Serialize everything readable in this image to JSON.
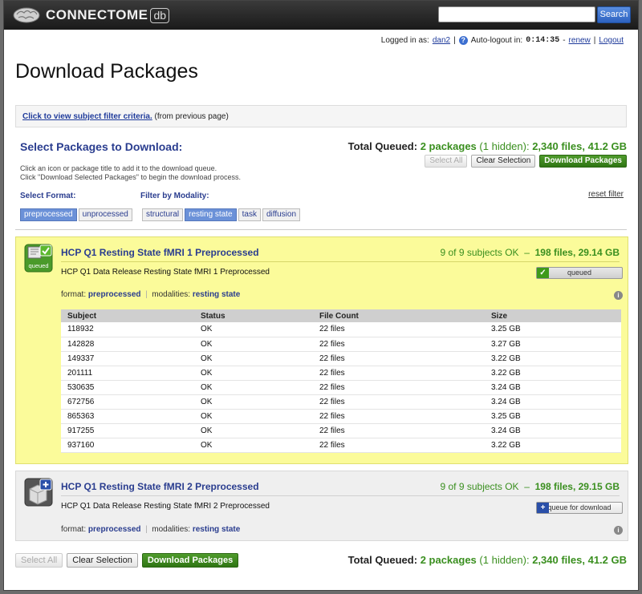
{
  "header": {
    "logo_text": "CONNECTOME",
    "logo_badge": "db",
    "search_placeholder": "",
    "search_button": "Search"
  },
  "userbar": {
    "logged_in_label": "Logged in as:",
    "username": "dan2",
    "sep1": "|",
    "auto_logout_label": "Auto-logout in:",
    "timer": "0:14:35",
    "dash": "-",
    "renew": "renew",
    "sep2": "|",
    "logout": "Logout"
  },
  "page_title": "Download Packages",
  "filter_bar": {
    "link": "Click to view subject filter criteria.",
    "note": "(from previous page)"
  },
  "select": {
    "heading": "Select Packages to Download:",
    "instruction_1": "Click an icon or package title to add it to the download queue.",
    "instruction_2": "Click \"Download Selected Packages\" to begin the download process."
  },
  "totals": {
    "label": "Total Queued:",
    "packages": "2 packages",
    "hidden": "(1 hidden):",
    "summary": "2,340 files, 41.2 GB"
  },
  "buttons": {
    "select_all": "Select All",
    "clear_selection": "Clear Selection",
    "download": "Download Packages"
  },
  "filters": {
    "format_label": "Select Format:",
    "modality_label": "Filter by Modality:",
    "reset": "reset filter",
    "formats": [
      {
        "label": "preprocessed",
        "active": true
      },
      {
        "label": "unprocessed",
        "active": false
      }
    ],
    "modalities": [
      {
        "label": "structural",
        "active": false
      },
      {
        "label": "resting state",
        "active": true
      },
      {
        "label": "task",
        "active": false
      },
      {
        "label": "diffusion",
        "active": false
      }
    ]
  },
  "packages": [
    {
      "title": "HCP Q1 Resting State fMRI 1 Preprocessed",
      "stats_ok": "9 of 9 subjects OK",
      "stats_dash": "–",
      "stats_size": "198 files, 29.14 GB",
      "description": "HCP Q1 Data Release Resting State fMRI 1 Preprocessed",
      "format_label": "format:",
      "format": "preprocessed",
      "modalities_label": "modalities:",
      "modality": "resting state",
      "status_button": "queued",
      "icon_badge": "queued",
      "table": {
        "headers": [
          "Subject",
          "Status",
          "File Count",
          "Size"
        ],
        "rows": [
          [
            "118932",
            "OK",
            "22 files",
            "3.25 GB"
          ],
          [
            "142828",
            "OK",
            "22 files",
            "3.27 GB"
          ],
          [
            "149337",
            "OK",
            "22 files",
            "3.22 GB"
          ],
          [
            "201111",
            "OK",
            "22 files",
            "3.22 GB"
          ],
          [
            "530635",
            "OK",
            "22 files",
            "3.24 GB"
          ],
          [
            "672756",
            "OK",
            "22 files",
            "3.24 GB"
          ],
          [
            "865363",
            "OK",
            "22 files",
            "3.25 GB"
          ],
          [
            "917255",
            "OK",
            "22 files",
            "3.24 GB"
          ],
          [
            "937160",
            "OK",
            "22 files",
            "3.22 GB"
          ]
        ]
      }
    },
    {
      "title": "HCP Q1 Resting State fMRI 2 Preprocessed",
      "stats_ok": "9 of 9 subjects OK",
      "stats_dash": "–",
      "stats_size": "198 files, 29.15 GB",
      "description": "HCP Q1 Data Release Resting State fMRI 2 Preprocessed",
      "format_label": "format:",
      "format": "preprocessed",
      "modalities_label": "modalities:",
      "modality": "resting state",
      "status_button": "queue for download"
    }
  ],
  "colors": {
    "accent_blue": "#2a3d8f",
    "ok_green": "#3a8f1f",
    "queued_bg": "#fbfb9a"
  }
}
